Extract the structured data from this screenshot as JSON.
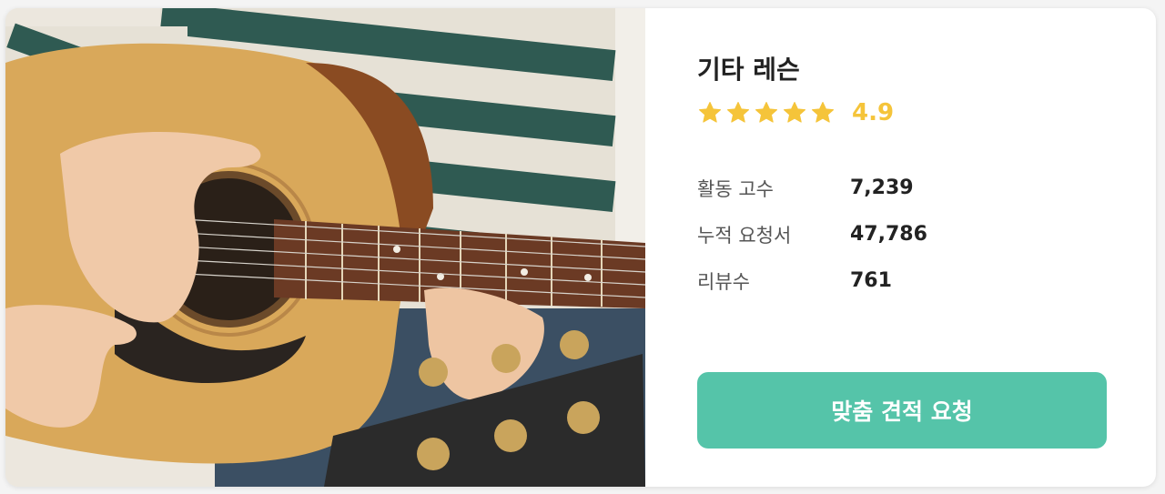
{
  "service": {
    "title": "기타 레슨",
    "rating_value": "4.9",
    "rating": 4.9,
    "rating_max": 5,
    "star_color": "#f5c43a"
  },
  "stats": [
    {
      "label": "활동 고수",
      "value": "7,239"
    },
    {
      "label": "누적 요청서",
      "value": "47,786"
    },
    {
      "label": "리뷰수",
      "value": "761"
    }
  ],
  "cta": {
    "label": "맞춤 견적 요청",
    "color": "#55c4a9"
  },
  "image": {
    "subject": "guitar-lesson-photo"
  }
}
